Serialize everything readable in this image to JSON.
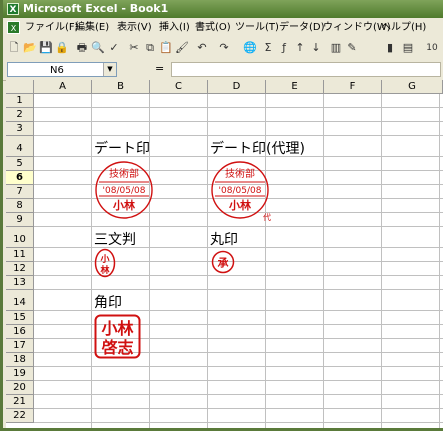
{
  "window": {
    "title": "Microsoft Excel - Book1",
    "app_icon_letter": "X"
  },
  "menubar": {
    "items": [
      "ファイル(F)",
      "編集(E)",
      "表示(V)",
      "挿入(I)",
      "書式(O)",
      "ツール(T)",
      "データ(D)",
      "ウィンドウ(W)",
      "ヘルプ(H)"
    ]
  },
  "toolbar": {
    "zoom_partial": "10"
  },
  "formula_bar": {
    "name_box": "N6",
    "equals": "=",
    "value": ""
  },
  "columns": [
    "A",
    "B",
    "C",
    "D",
    "E",
    "F",
    "G"
  ],
  "rows": [
    "1",
    "2",
    "3",
    "4",
    "5",
    "6",
    "7",
    "8",
    "9",
    "10",
    "11",
    "12",
    "13",
    "14",
    "15",
    "16",
    "17",
    "18",
    "19",
    "20",
    "21",
    "22"
  ],
  "cells": {
    "B4": "デート印",
    "D4": "デート印(代理)",
    "B10": "三文判",
    "D10": "丸印",
    "B14": "角印"
  },
  "stamps": {
    "date_stamp": {
      "top": "技術部",
      "middle": "'08/05/08",
      "bottom": "小林"
    },
    "date_stamp_proxy": {
      "top": "技術部",
      "middle": "'08/05/08",
      "bottom": "小林",
      "proxy_mark": "代"
    },
    "sanmon": {
      "line1": "小",
      "line2": "林"
    },
    "maru": {
      "text": "承"
    },
    "kaku": {
      "line1": "小林",
      "line2": "啓志"
    },
    "color": "#d01010"
  }
}
